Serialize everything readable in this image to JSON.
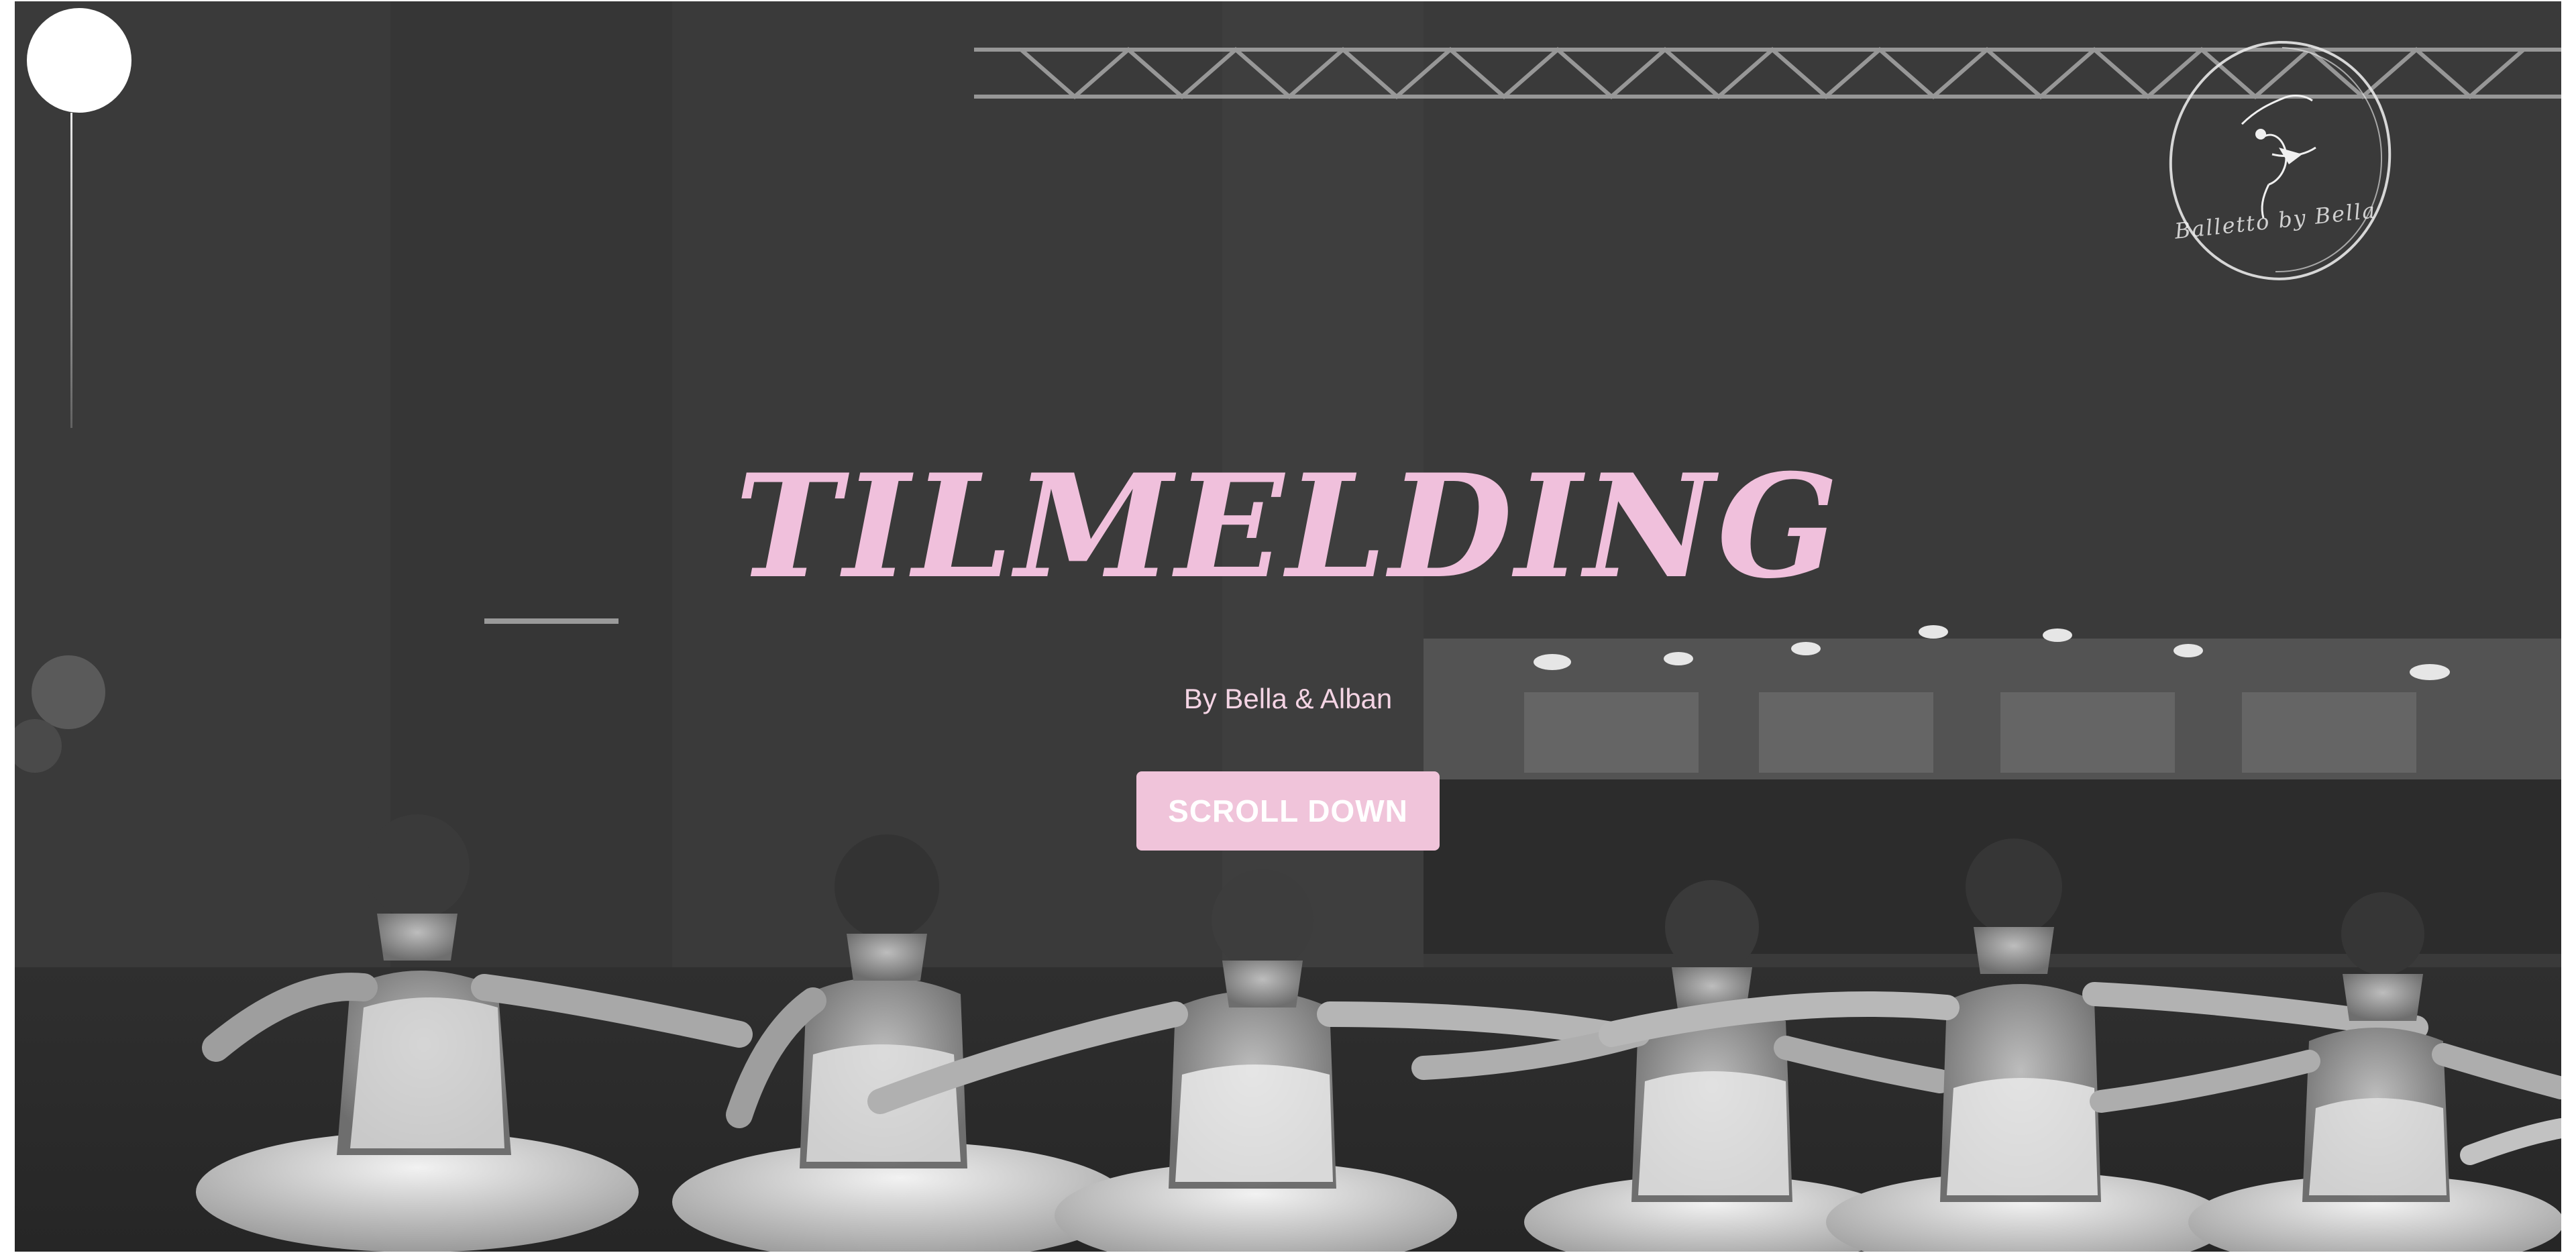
{
  "hero": {
    "title": "TILMELDING",
    "subtitle": "By Bella & Alban",
    "scroll_button_label": "SCROLL DOWN"
  },
  "logo": {
    "text": "Balletto by Bella",
    "icon": "ballerina-icon"
  },
  "menu": {
    "icon": "menu-circle-icon"
  },
  "colors": {
    "accent_pink": "#f0c0dc",
    "button_pink": "#f0c4da",
    "background_dark": "#3c3c3c"
  }
}
